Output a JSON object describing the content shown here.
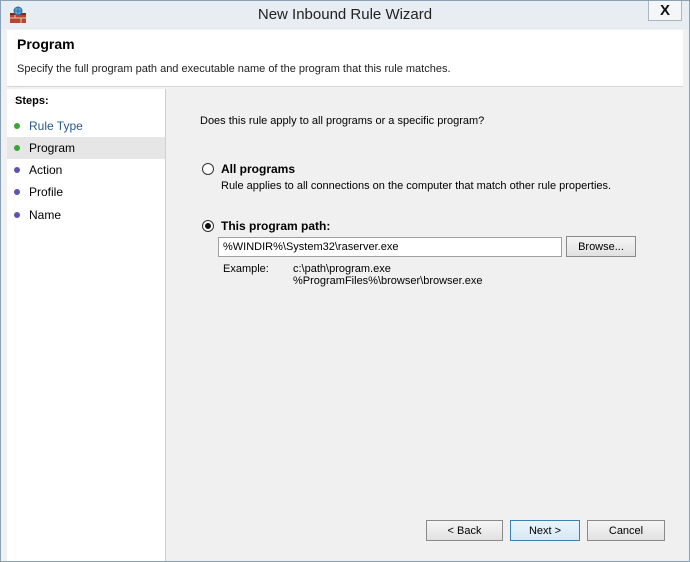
{
  "window": {
    "title": "New Inbound Rule Wizard",
    "close_glyph": "X"
  },
  "header": {
    "title": "Program",
    "description": "Specify the full program path and executable name of the program that this rule matches."
  },
  "steps": {
    "label": "Steps:",
    "items": [
      {
        "label": "Rule Type",
        "status": "completed",
        "dot_color": "#3aa33a",
        "text_color": "#2a5a8a"
      },
      {
        "label": "Program",
        "status": "current",
        "dot_color": "#3aa33a",
        "text_color": "#000000"
      },
      {
        "label": "Action",
        "status": "pending",
        "dot_color": "#5b55b0",
        "text_color": "#000000"
      },
      {
        "label": "Profile",
        "status": "pending",
        "dot_color": "#5b55b0",
        "text_color": "#000000"
      },
      {
        "label": "Name",
        "status": "pending",
        "dot_color": "#5b55b0",
        "text_color": "#000000"
      }
    ]
  },
  "content": {
    "question": "Does this rule apply to all programs or a specific program?",
    "all_programs": {
      "label": "All programs",
      "description": "Rule applies to all connections on the computer that match other rule properties.",
      "selected": false
    },
    "program_path": {
      "label": "This program path:",
      "selected": true,
      "value": "%WINDIR%\\System32\\raserver.exe",
      "browse_label": "Browse..."
    },
    "example": {
      "label": "Example:",
      "lines": [
        "c:\\path\\program.exe",
        "%ProgramFiles%\\browser\\browser.exe"
      ]
    }
  },
  "footer": {
    "back_label": "< Back",
    "next_label": "Next >",
    "cancel_label": "Cancel"
  }
}
